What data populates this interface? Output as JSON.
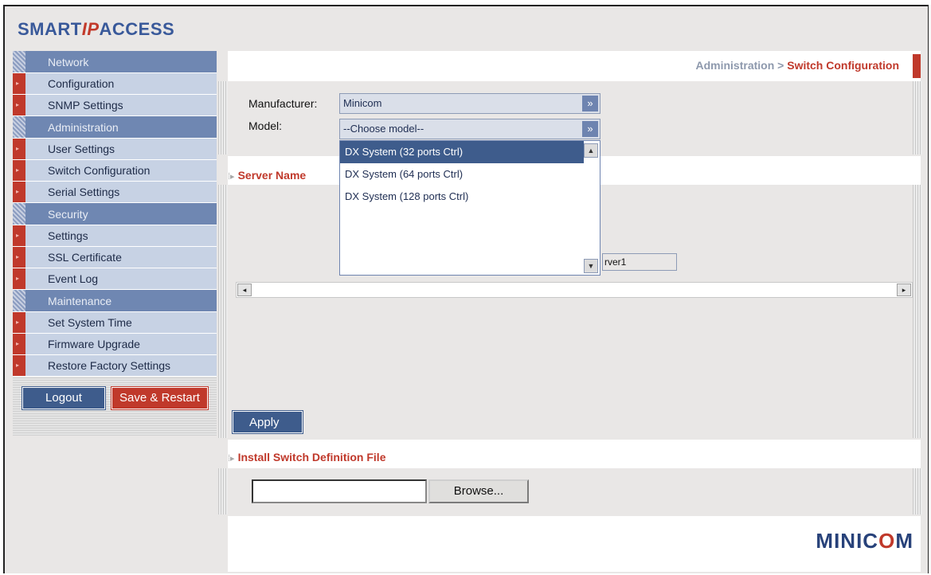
{
  "brand": {
    "logo_smart": "SMART",
    "logo_ip": "IP",
    "logo_access": "ACCESS",
    "footer_logo_pre": "MINIC",
    "footer_logo_o": "O",
    "footer_logo_post": "M"
  },
  "sidebar": {
    "sections": [
      {
        "title": "Network",
        "items": [
          "Configuration",
          "SNMP Settings"
        ]
      },
      {
        "title": "Administration",
        "items": [
          "User Settings",
          "Switch Configuration",
          "Serial Settings"
        ]
      },
      {
        "title": "Security",
        "items": [
          "Settings",
          "SSL Certificate",
          "Event Log"
        ]
      },
      {
        "title": "Maintenance",
        "items": [
          "Set System Time",
          "Firmware Upgrade",
          "Restore Factory Settings"
        ]
      }
    ],
    "logout_label": "Logout",
    "save_label": "Save & Restart"
  },
  "breadcrumb": {
    "parent": "Administration",
    "separator": ">",
    "current": "Switch Configuration"
  },
  "form": {
    "manufacturer_label": "Manufacturer:",
    "manufacturer_value": "Minicom",
    "model_label": "Model:",
    "model_value": "--Choose model--",
    "model_options": [
      "DX System (32 ports Ctrl)",
      "DX System (64 ports Ctrl)",
      "DX System (128 ports Ctrl)"
    ],
    "server_name_title": "Server Name",
    "server_value": "rver1",
    "apply_label": "Apply"
  },
  "install": {
    "title": "Install Switch Definition File",
    "file_value": "",
    "browse_label": "Browse..."
  }
}
